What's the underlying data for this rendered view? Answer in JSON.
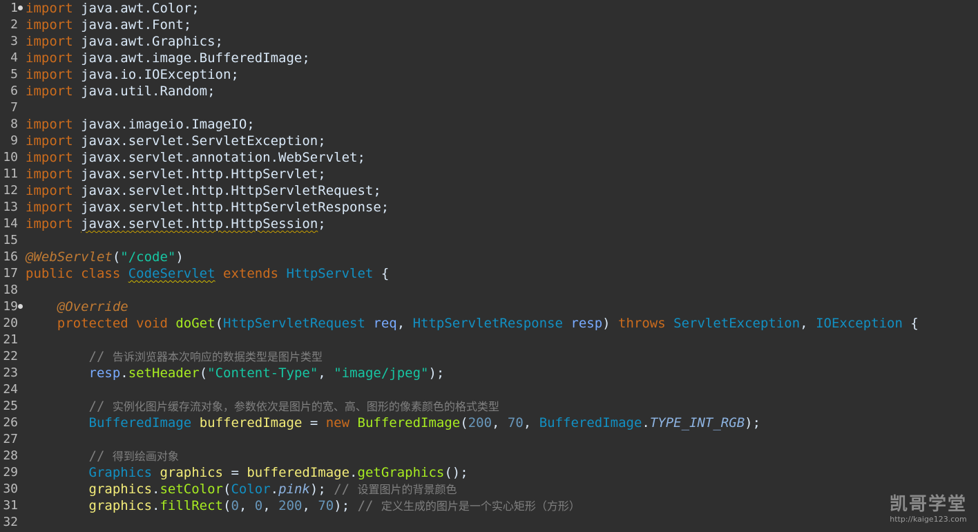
{
  "editor": {
    "lines": [
      {
        "n": "1",
        "fold": true,
        "tokens": [
          [
            "kw",
            "import"
          ],
          [
            "plain",
            " java.awt.Color;"
          ]
        ]
      },
      {
        "n": "2",
        "tokens": [
          [
            "kw",
            "import"
          ],
          [
            "plain",
            " java.awt.Font;"
          ]
        ]
      },
      {
        "n": "3",
        "tokens": [
          [
            "kw",
            "import"
          ],
          [
            "plain",
            " java.awt.Graphics;"
          ]
        ]
      },
      {
        "n": "4",
        "tokens": [
          [
            "kw",
            "import"
          ],
          [
            "plain",
            " java.awt.image.BufferedImage;"
          ]
        ]
      },
      {
        "n": "5",
        "tokens": [
          [
            "kw",
            "import"
          ],
          [
            "plain",
            " java.io.IOException;"
          ]
        ]
      },
      {
        "n": "6",
        "tokens": [
          [
            "kw",
            "import"
          ],
          [
            "plain",
            " java.util.Random;"
          ]
        ]
      },
      {
        "n": "7",
        "tokens": []
      },
      {
        "n": "8",
        "tokens": [
          [
            "kw",
            "import"
          ],
          [
            "plain",
            " javax.imageio.ImageIO;"
          ]
        ]
      },
      {
        "n": "9",
        "tokens": [
          [
            "kw",
            "import"
          ],
          [
            "plain",
            " javax.servlet.ServletException;"
          ]
        ]
      },
      {
        "n": "10",
        "tokens": [
          [
            "kw",
            "import"
          ],
          [
            "plain",
            " javax.servlet.annotation.WebServlet;"
          ]
        ]
      },
      {
        "n": "11",
        "tokens": [
          [
            "kw",
            "import"
          ],
          [
            "plain",
            " javax.servlet.http.HttpServlet;"
          ]
        ]
      },
      {
        "n": "12",
        "tokens": [
          [
            "kw",
            "import"
          ],
          [
            "plain",
            " javax.servlet.http.HttpServletRequest;"
          ]
        ]
      },
      {
        "n": "13",
        "tokens": [
          [
            "kw",
            "import"
          ],
          [
            "plain",
            " javax.servlet.http.HttpServletResponse;"
          ]
        ]
      },
      {
        "n": "14",
        "tokens": [
          [
            "kw",
            "import"
          ],
          [
            "plain",
            " "
          ],
          [
            "squig",
            "javax.servlet.http.HttpSession"
          ],
          [
            "plain",
            ";"
          ]
        ]
      },
      {
        "n": "15",
        "tokens": []
      },
      {
        "n": "16",
        "tokens": [
          [
            "ann",
            "@WebServlet"
          ],
          [
            "plain",
            "("
          ],
          [
            "str",
            "\"/code\""
          ],
          [
            "plain",
            ")"
          ]
        ]
      },
      {
        "n": "17",
        "tokens": [
          [
            "kw",
            "public class "
          ],
          [
            "typesquig",
            "CodeServlet"
          ],
          [
            "plain",
            " "
          ],
          [
            "kw",
            "extends"
          ],
          [
            "plain",
            " "
          ],
          [
            "type",
            "HttpServlet"
          ],
          [
            "plain",
            " {"
          ]
        ]
      },
      {
        "n": "18",
        "tokens": []
      },
      {
        "n": "19",
        "fold": true,
        "tokens": [
          [
            "plain",
            "    "
          ],
          [
            "ann",
            "@Override"
          ]
        ]
      },
      {
        "n": "20",
        "tokens": [
          [
            "plain",
            "    "
          ],
          [
            "kw",
            "protected void "
          ],
          [
            "method",
            "doGet"
          ],
          [
            "plain",
            "("
          ],
          [
            "type",
            "HttpServletRequest"
          ],
          [
            "plain",
            " "
          ],
          [
            "paramtxt",
            "req"
          ],
          [
            "plain",
            ", "
          ],
          [
            "type",
            "HttpServletResponse"
          ],
          [
            "plain",
            " "
          ],
          [
            "paramtxt",
            "resp"
          ],
          [
            "plain",
            ") "
          ],
          [
            "kw",
            "throws"
          ],
          [
            "plain",
            " "
          ],
          [
            "type",
            "ServletException"
          ],
          [
            "plain",
            ", "
          ],
          [
            "type",
            "IOException"
          ],
          [
            "plain",
            " {"
          ]
        ]
      },
      {
        "n": "21",
        "tokens": []
      },
      {
        "n": "22",
        "tokens": [
          [
            "plain",
            "        "
          ],
          [
            "cmtslash",
            "// "
          ],
          [
            "comment",
            "告诉浏览器本次响应的数据类型是图片类型"
          ]
        ]
      },
      {
        "n": "23",
        "tokens": [
          [
            "plain",
            "        "
          ],
          [
            "paramtxt",
            "resp"
          ],
          [
            "plain",
            "."
          ],
          [
            "method",
            "setHeader"
          ],
          [
            "plain",
            "("
          ],
          [
            "str",
            "\"Content-Type\""
          ],
          [
            "plain",
            ", "
          ],
          [
            "str",
            "\"image/jpeg\""
          ],
          [
            "plain",
            ");"
          ]
        ]
      },
      {
        "n": "24",
        "tokens": []
      },
      {
        "n": "25",
        "tokens": [
          [
            "plain",
            "        "
          ],
          [
            "cmtslash",
            "// "
          ],
          [
            "comment",
            "实例化图片缓存流对象，参数依次是图片的宽、高、图形的像素颜色的格式类型"
          ]
        ]
      },
      {
        "n": "26",
        "tokens": [
          [
            "plain",
            "        "
          ],
          [
            "type",
            "BufferedImage"
          ],
          [
            "plain",
            " "
          ],
          [
            "localvar",
            "bufferedImage"
          ],
          [
            "plain",
            " = "
          ],
          [
            "kw",
            "new"
          ],
          [
            "plain",
            " "
          ],
          [
            "method",
            "BufferedImage"
          ],
          [
            "plain",
            "("
          ],
          [
            "num",
            "200"
          ],
          [
            "plain",
            ", "
          ],
          [
            "num",
            "70"
          ],
          [
            "plain",
            ", "
          ],
          [
            "type",
            "BufferedImage"
          ],
          [
            "plain",
            "."
          ],
          [
            "statfield",
            "TYPE_INT_RGB"
          ],
          [
            "plain",
            ");"
          ]
        ]
      },
      {
        "n": "27",
        "tokens": []
      },
      {
        "n": "28",
        "tokens": [
          [
            "plain",
            "        "
          ],
          [
            "cmtslash",
            "// "
          ],
          [
            "comment",
            "得到绘画对象"
          ]
        ]
      },
      {
        "n": "29",
        "tokens": [
          [
            "plain",
            "        "
          ],
          [
            "type",
            "Graphics"
          ],
          [
            "plain",
            " "
          ],
          [
            "localvar",
            "graphics"
          ],
          [
            "plain",
            " = "
          ],
          [
            "localvar",
            "bufferedImage"
          ],
          [
            "plain",
            "."
          ],
          [
            "method",
            "getGraphics"
          ],
          [
            "plain",
            "();"
          ]
        ]
      },
      {
        "n": "30",
        "tokens": [
          [
            "plain",
            "        "
          ],
          [
            "localvar",
            "graphics"
          ],
          [
            "plain",
            "."
          ],
          [
            "method",
            "setColor"
          ],
          [
            "plain",
            "("
          ],
          [
            "type",
            "Color"
          ],
          [
            "plain",
            "."
          ],
          [
            "statfield",
            "pink"
          ],
          [
            "plain",
            "); "
          ],
          [
            "cmtslash",
            "// "
          ],
          [
            "comment",
            "设置图片的背景颜色"
          ]
        ]
      },
      {
        "n": "31",
        "tokens": [
          [
            "plain",
            "        "
          ],
          [
            "localvar",
            "graphics"
          ],
          [
            "plain",
            "."
          ],
          [
            "method",
            "fillRect"
          ],
          [
            "plain",
            "("
          ],
          [
            "num",
            "0"
          ],
          [
            "plain",
            ", "
          ],
          [
            "num",
            "0"
          ],
          [
            "plain",
            ", "
          ],
          [
            "num",
            "200"
          ],
          [
            "plain",
            ", "
          ],
          [
            "num",
            "70"
          ],
          [
            "plain",
            "); "
          ],
          [
            "cmtslash",
            "// "
          ],
          [
            "comment",
            "定义生成的图片是一个实心矩形（方形）"
          ]
        ]
      },
      {
        "n": "32",
        "tokens": []
      }
    ]
  },
  "watermark": {
    "title": "凯哥学堂",
    "url": "http://kaige123.com"
  },
  "colors": {
    "background": "#2f2f2f",
    "keyword": "#cc6c1d",
    "type": "#1290c3",
    "string": "#17c6a3",
    "method": "#a7ec21",
    "variable": "#f3ec79",
    "comment": "#808080"
  }
}
